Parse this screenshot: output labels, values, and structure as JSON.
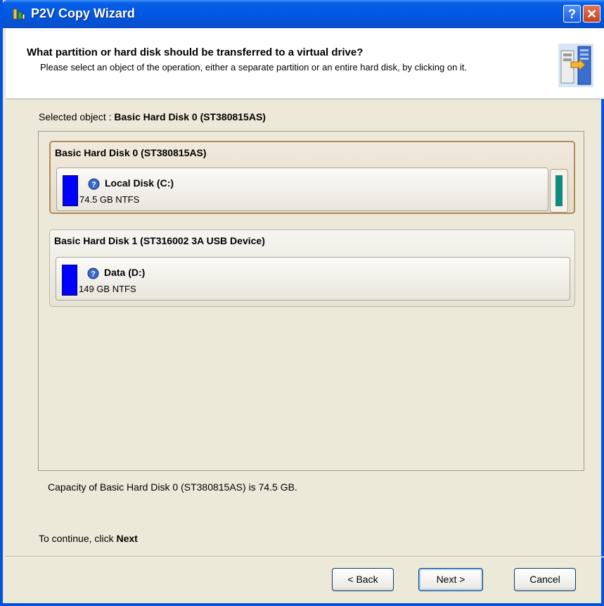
{
  "window": {
    "title": "P2V Copy Wizard",
    "help_label": "?",
    "close_label": "✕"
  },
  "header": {
    "title": "What partition or hard disk should be transferred to a virtual drive?",
    "description": "Please select an object of the operation, either a separate partition or an entire hard disk, by clicking on it."
  },
  "selected": {
    "prefix": "Selected object :",
    "value": "Basic Hard Disk 0 (ST380815AS)"
  },
  "disks": [
    {
      "title": "Basic Hard Disk 0 (ST380815AS)",
      "partition": {
        "name": "Local Disk (C:)",
        "size": "74.5 GB NTFS"
      },
      "selected": true
    },
    {
      "title": "Basic Hard Disk 1 (ST316002 3A USB Device)",
      "partition": {
        "name": "Data (D:)",
        "size": "149 GB NTFS"
      },
      "selected": false
    }
  ],
  "capacity_text": "Capacity of Basic Hard Disk 0 (ST380815AS) is 74.5 GB.",
  "continue": {
    "prefix": "To continue, click",
    "next_word": "Next"
  },
  "buttons": {
    "back": "< Back",
    "next": "Next >",
    "cancel": "Cancel"
  },
  "colors": {
    "partition_bar": "#0000ff",
    "unallocated_bar": "#108a7c",
    "titlebar": "#0058e6"
  },
  "icons": {
    "title": "p2v-wizard-icon",
    "partition": "question-disk-icon",
    "header": "server-migration-icon"
  }
}
